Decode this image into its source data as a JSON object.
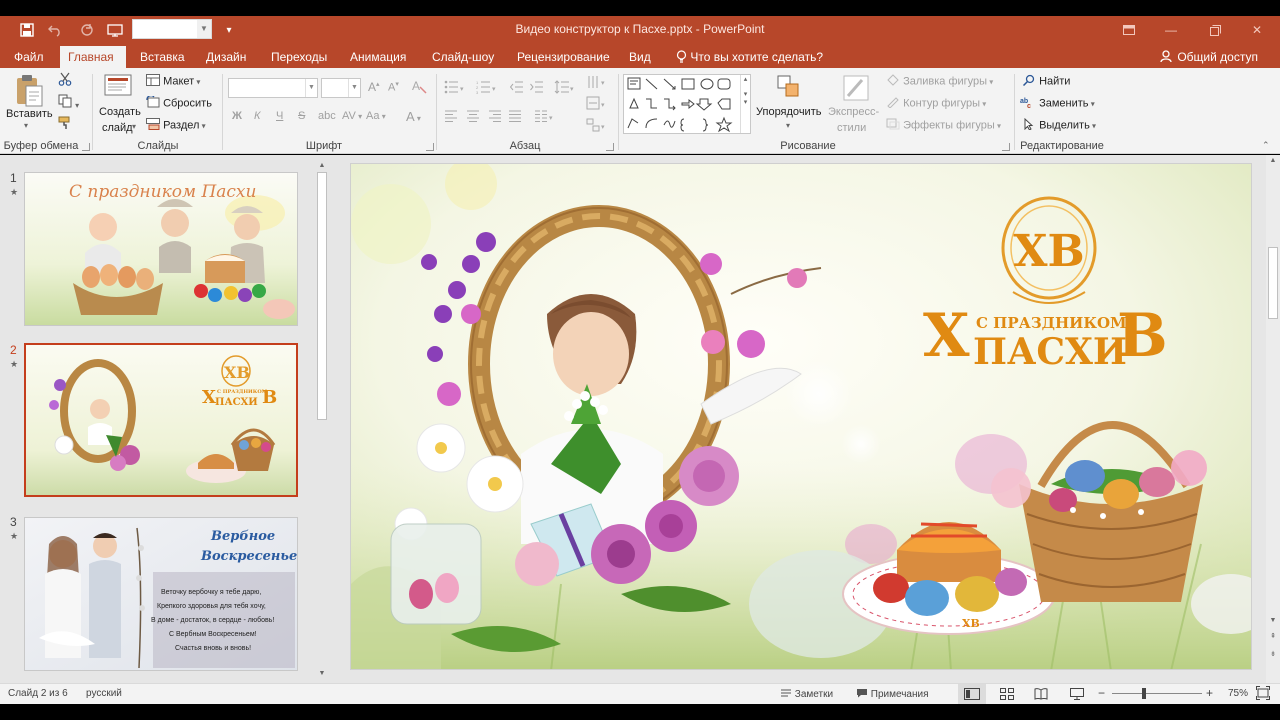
{
  "window": {
    "title": "Видео конструктор к Пасхе.pptx - PowerPoint"
  },
  "tabs": [
    {
      "label": "Файл"
    },
    {
      "label": "Главная"
    },
    {
      "label": "Вставка"
    },
    {
      "label": "Дизайн"
    },
    {
      "label": "Переходы"
    },
    {
      "label": "Анимация"
    },
    {
      "label": "Слайд-шоу"
    },
    {
      "label": "Рецензирование"
    },
    {
      "label": "Вид"
    }
  ],
  "tell_me": "Что вы хотите сделать?",
  "share": "Общий доступ",
  "ribbon": {
    "clipboard": {
      "paste": "Вставить",
      "group": "Буфер обмена"
    },
    "slides": {
      "new_slide_1": "Создать",
      "new_slide_2": "слайд",
      "layout": "Макет",
      "reset": "Сбросить",
      "section": "Раздел",
      "group": "Слайды"
    },
    "font": {
      "bold": "Ж",
      "italic": "К",
      "underline": "Ч",
      "strike": "S",
      "group": "Шрифт"
    },
    "paragraph": {
      "group": "Абзац"
    },
    "drawing": {
      "arrange": "Упорядочить",
      "quick_styles_1": "Экспресс-",
      "quick_styles_2": "стили",
      "fill": "Заливка фигуры",
      "outline": "Контур фигуры",
      "effects": "Эффекты фигуры",
      "group": "Рисование"
    },
    "editing": {
      "find": "Найти",
      "replace": "Заменить",
      "select": "Выделить",
      "group": "Редактирование"
    }
  },
  "slides": [
    {
      "number": "1",
      "star": "★",
      "title": "С праздником Пасхи"
    },
    {
      "number": "2",
      "star": "★",
      "hv": "ХВ",
      "line1": "С ПРАЗДНИКОМ",
      "line2": "ПАСХИ"
    },
    {
      "number": "3",
      "star": "★",
      "title1": "Вербное",
      "title2": "Воскресенье!",
      "poem": [
        "Веточку вербочку я тебе дарю,",
        "Крепкого здоровья для тебя хочу,",
        "В доме - достаток, в сердце - любовь!",
        "С Вербным Воскресеньем!",
        "Счастья вновь и вновь!"
      ]
    }
  ],
  "main_slide": {
    "monogram": "ХВ",
    "big_left": "Х",
    "big_right": "В",
    "line1": "С ПРАЗДНИКОМ",
    "line2": "ПАСХИ",
    "plate_label": "ХВ"
  },
  "status": {
    "slide_of": "Слайд 2 из 6",
    "language": "русский",
    "notes": "Заметки",
    "comments": "Примечания",
    "zoom": "75%"
  },
  "colors": {
    "accent": "#b7472a",
    "ribbon_bg": "#f3f3f3",
    "gold": "#e08a12"
  }
}
